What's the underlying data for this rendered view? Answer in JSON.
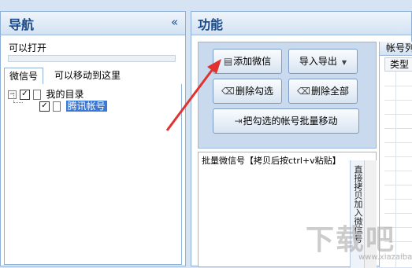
{
  "nav": {
    "title": "导航",
    "collapse_icon": "«",
    "sublabel": "可以打开",
    "progress": 0,
    "tabs": [
      {
        "label": "微信号",
        "active": true
      },
      {
        "label": "可以移动到这里",
        "active": false
      }
    ],
    "tree": {
      "root": {
        "expander": "−",
        "label": "我的目录",
        "checked": true
      },
      "child": {
        "label": "腾讯帐号",
        "checked": true,
        "selected": true
      }
    }
  },
  "func": {
    "title": "功能",
    "buttons": {
      "add": "添加微信",
      "import": "导入导出",
      "delete_checked": "删除勾选",
      "delete_all": "删除全部",
      "batch_move": "把勾选的帐号批量移动"
    },
    "batch": {
      "label": "批量微信号【拷贝后按ctrl+v粘贴】",
      "side_button": "直接拷贝加入微信号"
    },
    "account_list": {
      "header": "帐号列",
      "column": "类型"
    }
  },
  "watermark": {
    "text": "下载吧",
    "sub": "www.xiazaiba.com"
  },
  "colors": {
    "accent": "#1a4b8a",
    "arrow": "#e0332f",
    "selection": "#3a78d6"
  }
}
